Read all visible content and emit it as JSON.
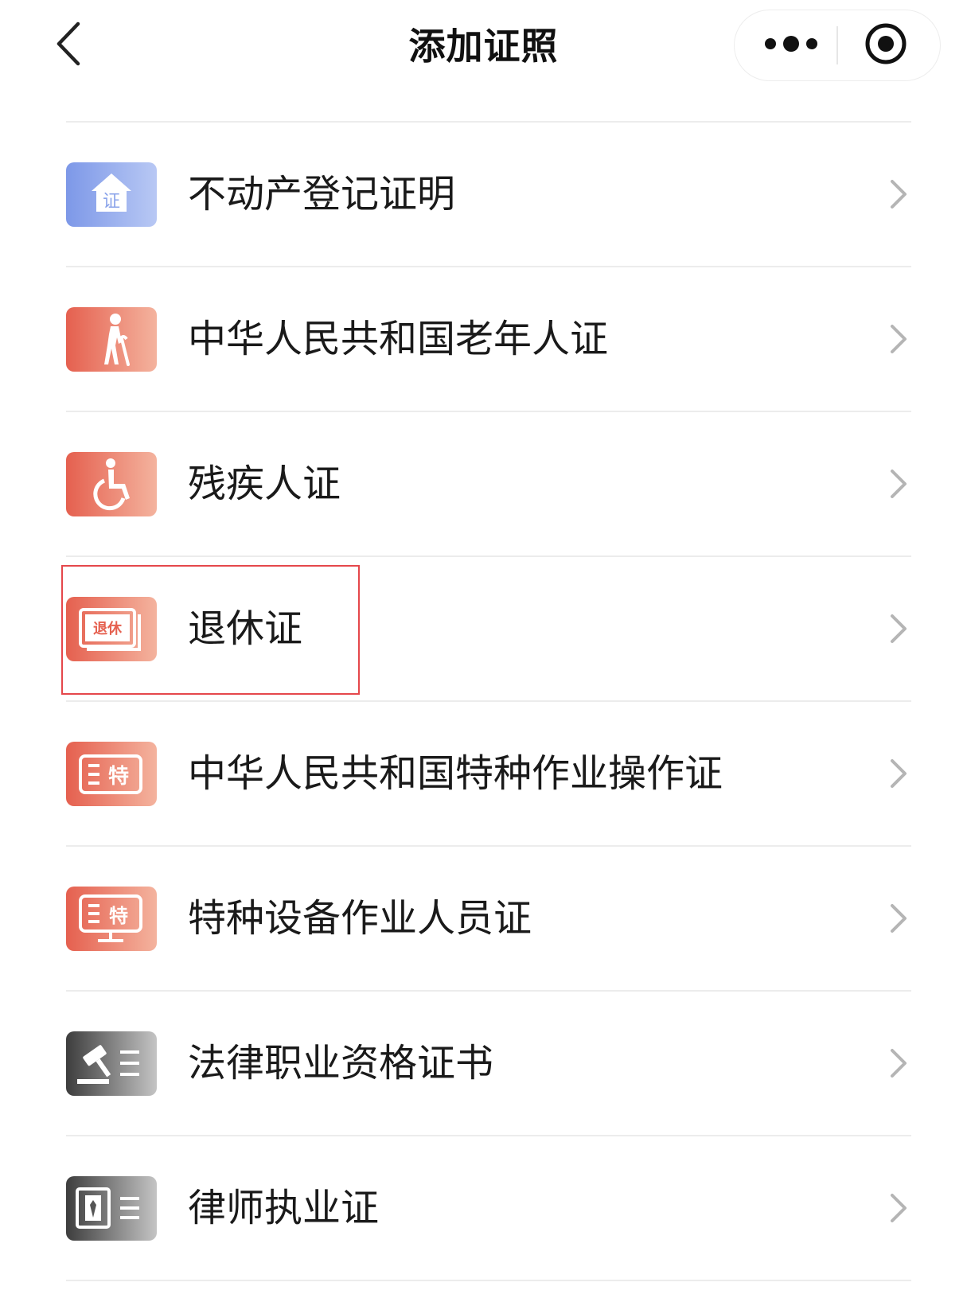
{
  "nav": {
    "title": "添加证照"
  },
  "colors": {
    "accent_red": "#e5474b",
    "icon_blue": "#8aa3ea",
    "icon_orange": "#ea7466",
    "icon_dark": "#5a5a5a"
  },
  "items": [
    {
      "label": "不动产登记证明",
      "icon": "house-certificate-icon",
      "icon_text": "证"
    },
    {
      "label": "中华人民共和国老年人证",
      "icon": "elderly-person-icon"
    },
    {
      "label": "残疾人证",
      "icon": "wheelchair-icon"
    },
    {
      "label": "退休证",
      "icon": "retirement-card-icon",
      "icon_text": "退休"
    },
    {
      "label": "中华人民共和国特种作业操作证",
      "icon": "special-operation-card-icon",
      "icon_text": "特"
    },
    {
      "label": "特种设备作业人员证",
      "icon": "special-equipment-monitor-icon",
      "icon_text": "特"
    },
    {
      "label": "法律职业资格证书",
      "icon": "gavel-icon"
    },
    {
      "label": "律师执业证",
      "icon": "lawyer-id-icon"
    }
  ]
}
